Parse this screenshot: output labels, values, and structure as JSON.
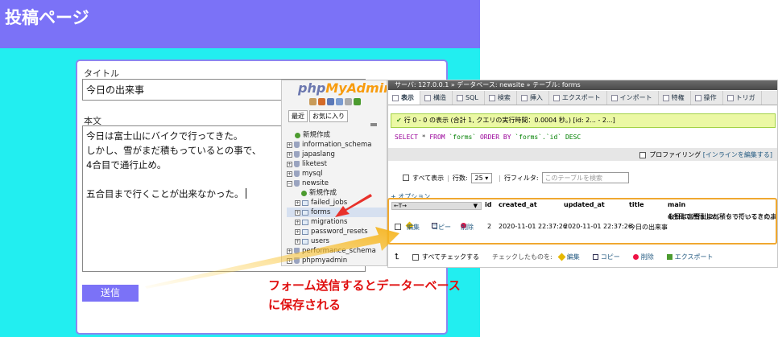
{
  "page": {
    "title": "投稿ページ"
  },
  "form": {
    "title_label": "タイトル",
    "title_value": "今日の出来事",
    "body_label": "本文",
    "body_lines": [
      "今日は富士山にバイクで行ってきた。",
      "しかし、雪がまだ積もっているとの事で、",
      "4合目で通行止め。"
    ],
    "body_last_line": "五合目まで行くことが出来なかった。",
    "submit_label": "送信"
  },
  "pma": {
    "logo_a": "php",
    "logo_b": "MyAdmin",
    "nav_tabs": [
      "最近",
      "お気に入り"
    ],
    "tree": {
      "new": "新規作成",
      "dbs": [
        "information_schema",
        "japaslang",
        "liketest",
        "mysql",
        "newsite"
      ],
      "newsite_new": "新規作成",
      "tables": [
        "failed_jobs",
        "forms",
        "migrations",
        "password_resets",
        "users"
      ],
      "more_dbs": [
        "performance_schema",
        "phpmyadmin"
      ]
    },
    "breadcrumb": "サーバ: 127.0.0.1 » データベース: newsite » テーブル: forms",
    "tabs": [
      "表示",
      "構造",
      "SQL",
      "検索",
      "挿入",
      "エクスポート",
      "インポート",
      "特権",
      "操作",
      "トリガ"
    ],
    "ok_message": "行 0 - 0 の表示 (合計 1, クエリの実行時間：0.0004 秒。) [id: 2... - 2...]",
    "sql": {
      "select": "SELECT",
      "star": " * ",
      "from": "FROM",
      "table": " `forms` ",
      "order": "ORDER BY",
      "tail": " `forms`.`id` DESC"
    },
    "profiling": "プロファイリング",
    "inline_edit": "[インラインを編集する]",
    "show_all": "すべて表示",
    "rows_label": "行数:",
    "rows_value": "25",
    "row_filter_label": "行フィルタ:",
    "row_filter_placeholder": "このテーブルを検索",
    "options": "+ オプション",
    "columns": {
      "arrows": "←T→",
      "id": "id",
      "created_at": "created_at",
      "updated_at": "updated_at",
      "title": "title",
      "main": "main"
    },
    "row": {
      "edit": "編集",
      "copy": "コピー",
      "delete": "削除",
      "id": "2",
      "created_at": "2020-11-01 22:37:26",
      "updated_at": "2020-11-01 22:37:26",
      "title": "今日の出来事",
      "main_lines": [
        "今日は富士山にバイクで行ってきた。",
        "しかし、雪がまだ積もっているとの事で、",
        "4合目で通行止め。",
        "..."
      ]
    },
    "bottom": {
      "check_all": "すべてチェックする",
      "checked": "チェックしたものを:",
      "edit": "編集",
      "copy": "コピー",
      "delete": "削除",
      "export": "エクスポート"
    }
  },
  "annotation": {
    "line1": "フォーム送信するとデーターベース",
    "line2": "に保存される"
  },
  "colors": {
    "header": "#7b72f7",
    "background": "#22eef0",
    "highlight": "#f0a830",
    "annotation": "#e01010"
  }
}
